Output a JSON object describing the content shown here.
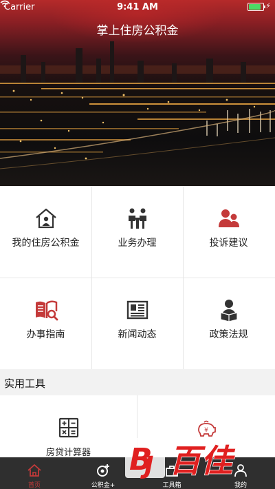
{
  "status_bar": {
    "carrier": "Carrier",
    "time": "9:41 AM"
  },
  "header": {
    "title": "掌上住房公积金"
  },
  "grid": {
    "items": [
      {
        "label": "我的住房公积金",
        "icon": "house-person-icon"
      },
      {
        "label": "业务办理",
        "icon": "service-counter-icon"
      },
      {
        "label": "投诉建议",
        "icon": "people-icon"
      },
      {
        "label": "办事指南",
        "icon": "book-search-icon"
      },
      {
        "label": "新闻动态",
        "icon": "newspaper-icon"
      },
      {
        "label": "政策法规",
        "icon": "reading-person-icon"
      }
    ]
  },
  "tools_section": {
    "title": "实用工具",
    "items": [
      {
        "label": "房贷计算器",
        "icon": "calculator-icon"
      },
      {
        "label": "",
        "icon": "piggy-bank-icon"
      }
    ]
  },
  "tabbar": {
    "items": [
      {
        "label": "首页",
        "icon": "home-icon",
        "active": true
      },
      {
        "label": "公积金+",
        "icon": "plus-coin-icon",
        "active": false
      },
      {
        "label": "工具箱",
        "icon": "toolbox-icon",
        "active": false
      },
      {
        "label": "我的",
        "icon": "user-icon",
        "active": false
      }
    ]
  },
  "watermark": {
    "text": "百佳"
  },
  "colors": {
    "accent": "#c43a3a",
    "tabbar_bg": "#2f2f2f",
    "icon_dark": "#333333",
    "watermark_red": "#e02020"
  }
}
